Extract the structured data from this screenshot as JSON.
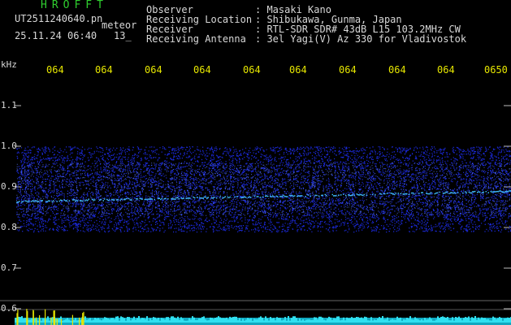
{
  "header": {
    "title": "HROFFT",
    "filename": "UT2511240640.pn",
    "mode": "meteor",
    "datetime": "25.11.24 06:40",
    "count": "13_"
  },
  "station_info": [
    {
      "label": "Observer",
      "value": ": Masaki Kano"
    },
    {
      "label": "Receiving Location",
      "value": ": Shibukawa, Gunma, Japan"
    },
    {
      "label": "Receiver",
      "value": ": RTL-SDR SDR# 43dB L15 103.2MHz CW"
    },
    {
      "label": "Receiving Antenna",
      "value": ": 3el Yagi(V) Az 330 for Vladivostok"
    }
  ],
  "chart_data": {
    "type": "heatmap",
    "ylabel": "kHz",
    "y_ticks": [
      "1.1",
      "1.0",
      "0.9",
      "0.8",
      "0.7",
      "0.6"
    ],
    "ylim": [
      0.6,
      1.1
    ],
    "x_ticks": [
      "064",
      "064",
      "064",
      "064",
      "064",
      "064",
      "064",
      "064",
      "064",
      "0650"
    ],
    "noise_band_khz": [
      0.79,
      1.0
    ],
    "carrier_khz_start": 0.865,
    "carrier_khz_end": 0.89
  },
  "colors": {
    "background": "#000000",
    "noise": "#2030ff",
    "carrier": "#40c0ff",
    "ticks": "#e6e600",
    "text": "#d8d8d8",
    "title": "#2fcf2f"
  }
}
